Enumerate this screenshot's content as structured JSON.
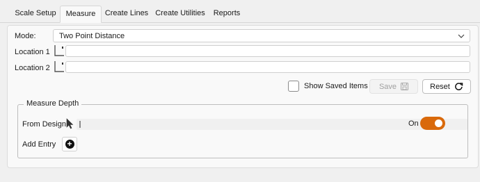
{
  "tabs": [
    {
      "label": "Scale Setup"
    },
    {
      "label": "Measure"
    },
    {
      "label": "Create Lines"
    },
    {
      "label": "Create Utilities"
    },
    {
      "label": "Reports"
    }
  ],
  "active_tab": "Measure",
  "mode": {
    "label": "Mode:",
    "value": "Two Point Distance",
    "icon": "chevron-down-icon"
  },
  "location1": {
    "label": "Location 1",
    "value": "",
    "icon": "point-picker-icon"
  },
  "location2": {
    "label": "Location 2",
    "value": "",
    "icon": "point-picker-icon"
  },
  "show_saved": {
    "label": "Show Saved Items",
    "checked": false
  },
  "save_button": {
    "label": "Save",
    "icon": "floppy-disk-icon",
    "enabled": false
  },
  "reset_button": {
    "label": "Reset",
    "icon": "refresh-icon"
  },
  "measure_depth": {
    "title": "Measure Depth",
    "from_design_label": "From Design:",
    "toggle_label": "On",
    "toggle_on": true,
    "add_entry_label": "Add Entry",
    "add_icon": "plus-circle-icon"
  },
  "colors": {
    "accent": "#d9690b"
  }
}
